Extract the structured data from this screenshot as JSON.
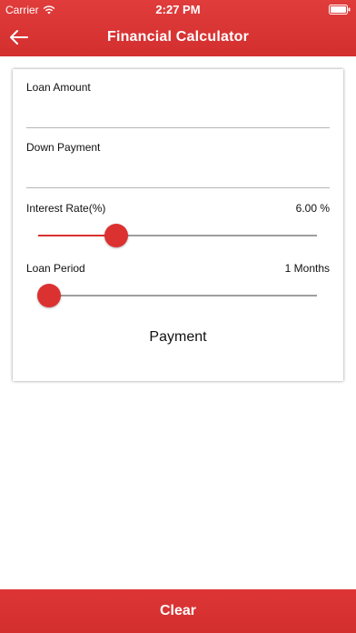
{
  "status_bar": {
    "carrier": "Carrier",
    "time": "2:27 PM"
  },
  "header": {
    "title": "Financial Calculator"
  },
  "form": {
    "loan_amount": {
      "label": "Loan Amount",
      "value": "",
      "placeholder": ""
    },
    "down_payment": {
      "label": "Down Payment",
      "value": "",
      "placeholder": ""
    },
    "interest_rate": {
      "label": "Interest Rate(%)",
      "value_text": "6.00 %",
      "slider_fraction": 0.28
    },
    "loan_period": {
      "label": "Loan Period",
      "value_text": "1 Months",
      "slider_fraction": 0.04
    },
    "result_label": "Payment"
  },
  "footer": {
    "clear_label": "Clear"
  },
  "colors": {
    "accent": "#d93030",
    "track": "#9e9e9e"
  }
}
